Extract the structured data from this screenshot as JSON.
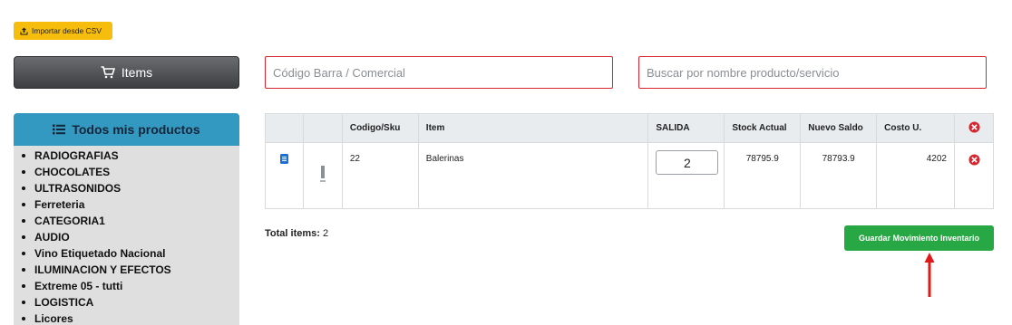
{
  "toolbar": {
    "import_label": "Importar desde CSV"
  },
  "items_button": {
    "label": "Items"
  },
  "search": {
    "barcode_placeholder": "Código Barra / Comercial",
    "name_placeholder": "Buscar por nombre producto/servicio"
  },
  "categories": {
    "title": "Todos mis productos",
    "items": [
      "RADIOGRAFIAS",
      "CHOCOLATES",
      "ULTRASONIDOS",
      "Ferreteria",
      "CATEGORIA1",
      "AUDIO",
      "Vino Etiquetado Nacional",
      "ILUMINACION Y EFECTOS",
      "Extreme 05 - tutti",
      "LOGISTICA",
      "Licores"
    ]
  },
  "table": {
    "headers": {
      "code": "Codigo/Sku",
      "item": "Item",
      "salida": "SALIDA",
      "stock": "Stock Actual",
      "nuevo": "Nuevo Saldo",
      "costo": "Costo U."
    },
    "rows": [
      {
        "code": "22",
        "item": "Balerinas",
        "salida": "2",
        "stock": "78795.9",
        "nuevo": "78793.9",
        "costo": "4202"
      }
    ]
  },
  "summary": {
    "total_label": "Total items:",
    "total_value": "2"
  },
  "actions": {
    "save_label": "Guardar Movimiento Inventario"
  },
  "colors": {
    "accent_green": "#28a745",
    "import_yellow": "#f6bd0c",
    "category_blue": "#3399c0",
    "error_red": "#d9252f"
  }
}
